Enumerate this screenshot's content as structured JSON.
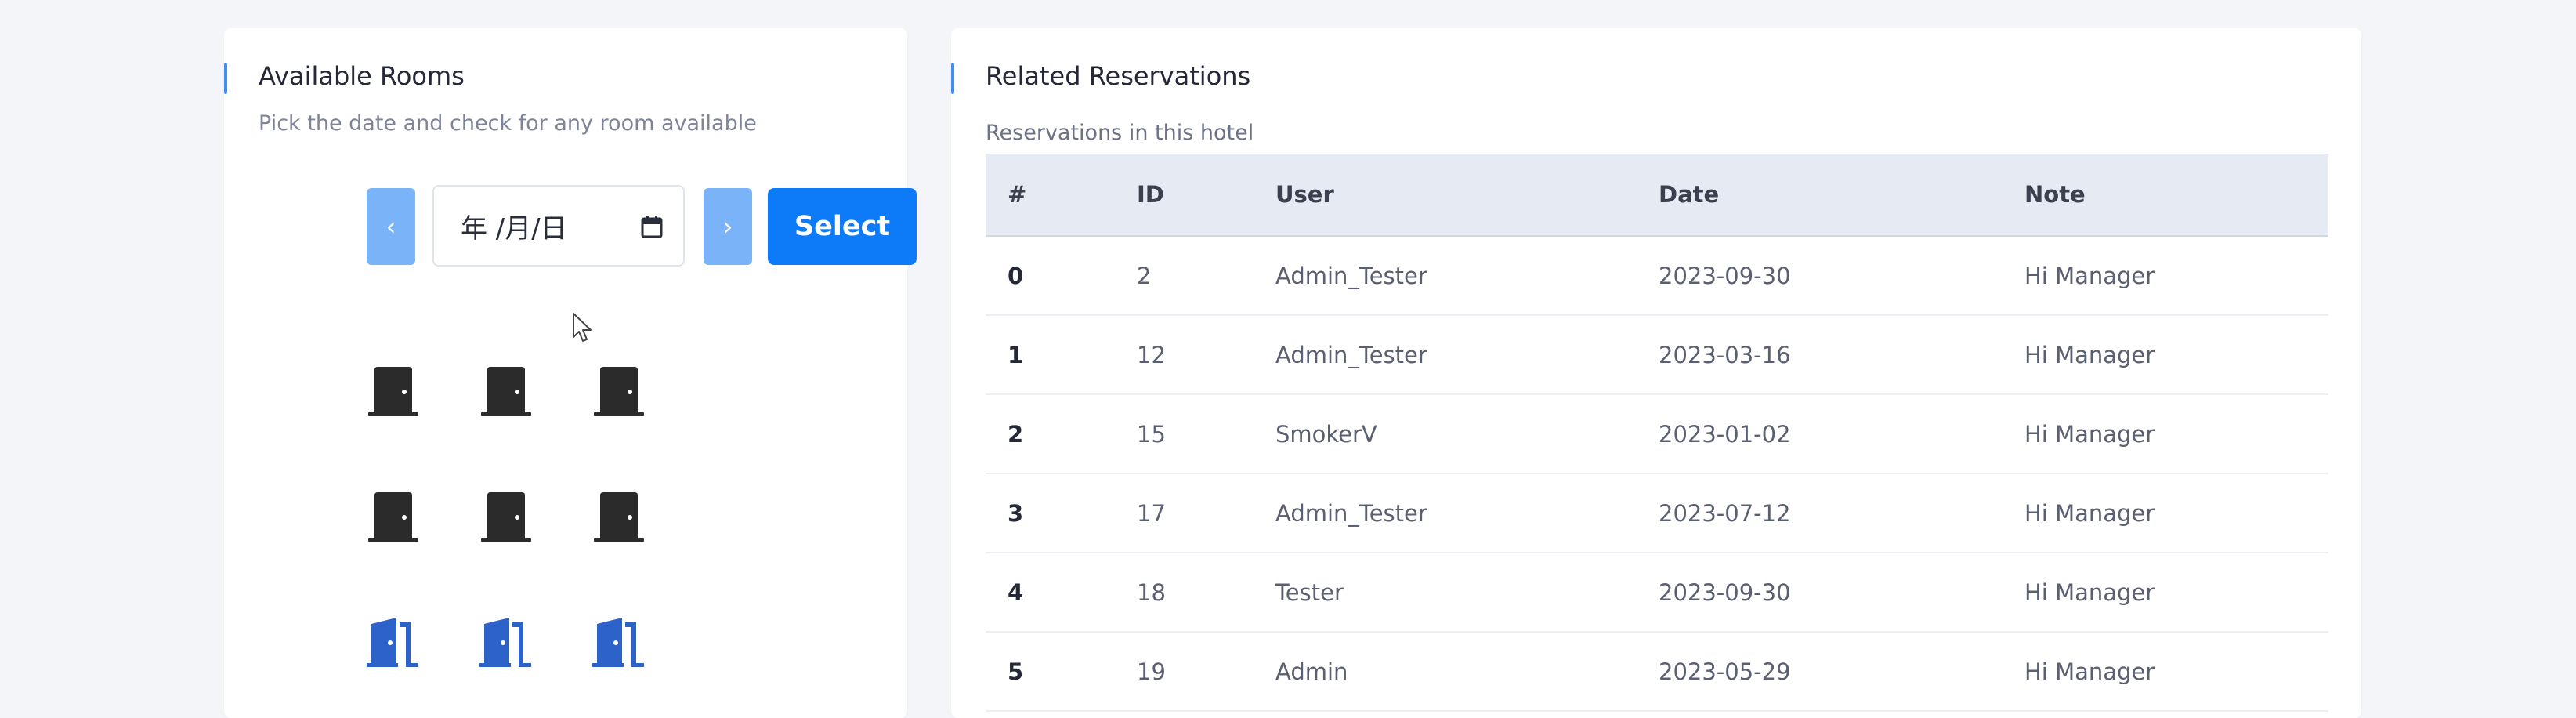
{
  "rooms_panel": {
    "title": "Available Rooms",
    "subtitle": "Pick the date and check for any room available",
    "prev_label": "‹",
    "next_label": "›",
    "date_value": "年 /月/日",
    "select_label": "Select",
    "rooms": [
      {
        "status": "occupied",
        "icon": "door-closed-icon",
        "color": "#2b2b2b"
      },
      {
        "status": "occupied",
        "icon": "door-closed-icon",
        "color": "#2b2b2b"
      },
      {
        "status": "occupied",
        "icon": "door-closed-icon",
        "color": "#2b2b2b"
      },
      {
        "status": "occupied",
        "icon": "door-closed-icon",
        "color": "#2b2b2b"
      },
      {
        "status": "occupied",
        "icon": "door-closed-icon",
        "color": "#2b2b2b"
      },
      {
        "status": "occupied",
        "icon": "door-closed-icon",
        "color": "#2b2b2b"
      },
      {
        "status": "available",
        "icon": "door-open-icon",
        "color": "#2c62c9"
      },
      {
        "status": "available",
        "icon": "door-open-icon",
        "color": "#2c62c9"
      },
      {
        "status": "available",
        "icon": "door-open-icon",
        "color": "#2c62c9"
      }
    ]
  },
  "reservations_panel": {
    "title": "Related Reservations",
    "subtitle": "Reservations in this hotel",
    "columns": [
      "#",
      "ID",
      "User",
      "Date",
      "Note"
    ],
    "rows": [
      [
        "0",
        "2",
        "Admin_Tester",
        "2023-09-30",
        "Hi Manager"
      ],
      [
        "1",
        "12",
        "Admin_Tester",
        "2023-03-16",
        "Hi Manager"
      ],
      [
        "2",
        "15",
        "SmokerV",
        "2023-01-02",
        "Hi Manager"
      ],
      [
        "3",
        "17",
        "Admin_Tester",
        "2023-07-12",
        "Hi Manager"
      ],
      [
        "4",
        "18",
        "Tester",
        "2023-09-30",
        "Hi Manager"
      ],
      [
        "5",
        "19",
        "Admin",
        "2023-05-29",
        "Hi Manager"
      ]
    ]
  },
  "colors": {
    "accent": "#3f8df5",
    "select_button": "#0d7bf8",
    "nav_button": "#7bb3f8",
    "table_header_bg": "#e6ebf3"
  }
}
